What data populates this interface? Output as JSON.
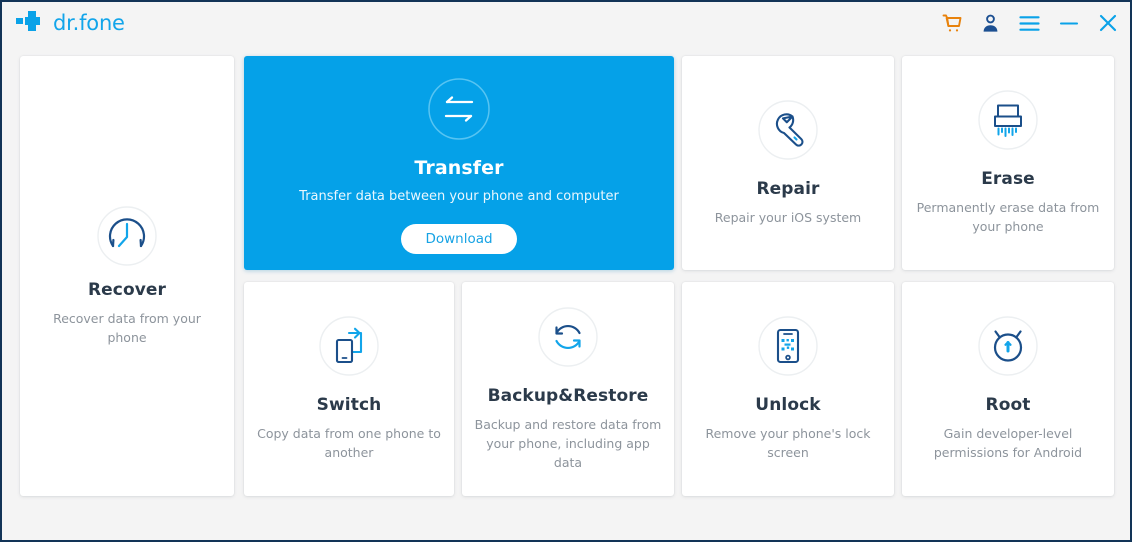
{
  "window": {
    "brand_name": "dr.fone",
    "brand_logo_icon": "plus-cross-logo",
    "controls": [
      {
        "name": "cart-icon",
        "label": "Cart",
        "color": "#e8820c"
      },
      {
        "name": "account-icon",
        "label": "Account",
        "color": "#1c4f91"
      },
      {
        "name": "menu-icon",
        "label": "Menu",
        "color": "#0aa2e8"
      },
      {
        "name": "minimize-icon",
        "label": "Minimize",
        "color": "#0aa2e8"
      },
      {
        "name": "close-icon",
        "label": "Close",
        "color": "#0aa2e8"
      }
    ]
  },
  "theme": {
    "accent": "#05a1e8",
    "window_border": "#123457",
    "background": "#f4f4f4",
    "tile_background": "#ffffff",
    "title_text": "#2b3a4a",
    "desc_text": "#8d949c",
    "icon_dark": "#1b4f8a",
    "icon_light": "#12a5ea",
    "cart_orange": "#e8820c"
  },
  "tiles": {
    "recover": {
      "title": "Recover",
      "desc": "Recover data from your phone",
      "icon": "clock-recover-icon"
    },
    "transfer": {
      "title": "Transfer",
      "desc": "Transfer data between your phone and computer",
      "icon": "transfer-arrows-icon",
      "button_label": "Download",
      "featured": true
    },
    "repair": {
      "title": "Repair",
      "desc": "Repair your iOS system",
      "icon": "wrench-icon"
    },
    "erase": {
      "title": "Erase",
      "desc": "Permanently erase data from your phone",
      "icon": "shredder-icon"
    },
    "switch": {
      "title": "Switch",
      "desc": "Copy data from one phone to another",
      "icon": "phone-switch-icon"
    },
    "backup": {
      "title": "Backup&Restore",
      "desc": "Backup and restore data from your phone, including app data",
      "icon": "circular-arrows-icon"
    },
    "unlock": {
      "title": "Unlock",
      "desc": "Remove your phone's lock screen",
      "icon": "phone-lock-icon"
    },
    "root": {
      "title": "Root",
      "desc": "Gain developer-level permissions for Android",
      "icon": "android-head-icon"
    }
  }
}
